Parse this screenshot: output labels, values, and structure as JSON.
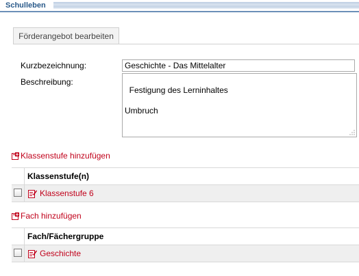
{
  "header": {
    "title": "Schulleben"
  },
  "tab": {
    "label": "Förderangebot bearbeiten"
  },
  "form": {
    "kurz_label": "Kurzbezeichnung:",
    "kurz_value": "Geschichte - Das Mittelalter",
    "beschreibung_label": "Beschreibung:",
    "beschreibung_value": "Festigung des Lerninhaltes\n\nUmbruch"
  },
  "klassenstufe": {
    "add_label": "Klassenstufe hinzufügen",
    "column_header": "Klassenstufe(n)",
    "rows": [
      {
        "label": "Klassenstufe 6",
        "checked": false
      }
    ]
  },
  "fach": {
    "add_label": "Fach hinzufügen",
    "column_header": "Fach/Fächergruppe",
    "rows": [
      {
        "label": "Geschichte",
        "checked": false
      }
    ]
  },
  "colors": {
    "link": "#c0001a",
    "header_blue": "#2a5a8a"
  },
  "icons": {
    "add": "add-row-icon",
    "edit": "edit-icon"
  }
}
